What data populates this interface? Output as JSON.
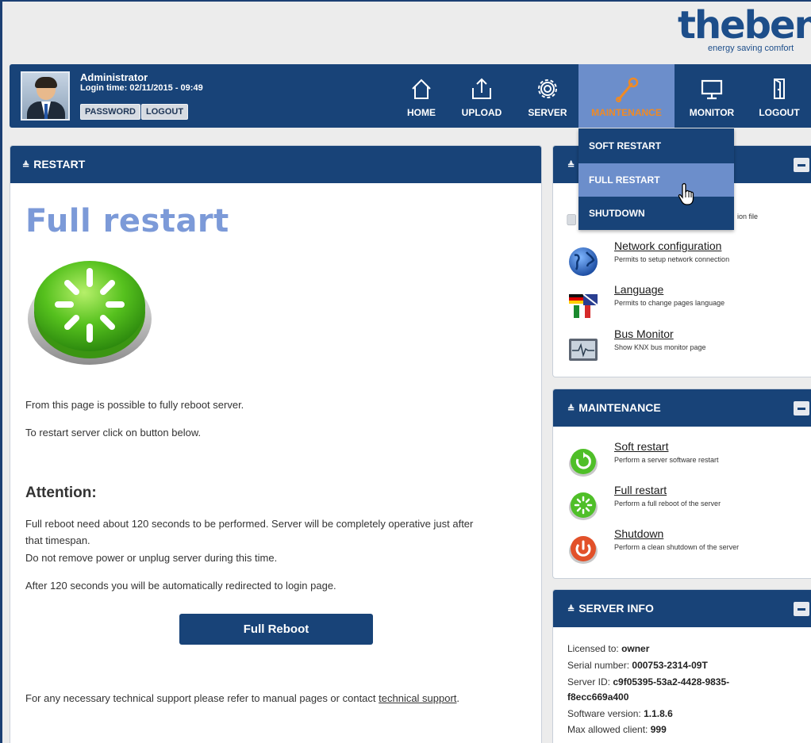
{
  "brand": {
    "logo_text": "theben",
    "tagline": "energy saving comfort"
  },
  "user": {
    "name": "Administrator",
    "login_time": "Login time: 02/11/2015 - 09:49",
    "password_label": "PASSWORD",
    "logout_label": "LOGOUT"
  },
  "nav": {
    "home": "HOME",
    "upload": "UPLOAD",
    "server": "SERVER",
    "maintenance": "MAINTENANCE",
    "monitor": "MONITOR",
    "logout": "LOGOUT"
  },
  "dropdown": {
    "items": [
      "SOFT RESTART",
      "FULL RESTART",
      "SHUTDOWN"
    ],
    "hovered": "FULL RESTART"
  },
  "main": {
    "header": "RESTART",
    "title": "Full restart",
    "intro1": "From this page is possible to fully reboot server.",
    "intro2": "To restart server click on button below.",
    "attention_title": "Attention:",
    "attention_line1": "Full reboot need about 120 seconds to be performed. Server will be completely operative just after",
    "attention_line2": "that timespan.",
    "attention_line3": "Do not remove power or unplug server during this time.",
    "redirect_note": "After 120 seconds you will be automatically redirected to login page.",
    "button_label": "Full Reboot",
    "support_prefix": "For any necessary technical support please refer to manual pages or contact ",
    "support_link": "technical support",
    "support_suffix": "."
  },
  "server_panel": {
    "partial_desc": "ion file",
    "items": [
      {
        "title": "Network configuration",
        "desc": "Permits to setup network connection"
      },
      {
        "title": "Language",
        "desc": "Permits to change pages language"
      },
      {
        "title": "Bus Monitor",
        "desc": "Show KNX bus monitor page"
      }
    ]
  },
  "maintenance_panel": {
    "header": "MAINTENANCE",
    "items": [
      {
        "title": "Soft restart",
        "desc": "Perform a server software restart"
      },
      {
        "title": "Full restart",
        "desc": "Perform a full reboot of the server"
      },
      {
        "title": "Shutdown",
        "desc": "Perform a clean shutdown of the server"
      }
    ]
  },
  "server_info": {
    "header": "SERVER INFO",
    "licensed_label": "Licensed to:",
    "licensed_value": "owner",
    "serial_label": "Serial number:",
    "serial_value": "000753-2314-09T",
    "server_id_label": "Server ID:",
    "server_id_value1": "c9f05395-53a2-4428-9835-",
    "server_id_value2": "f8ecc669a400",
    "software_label": "Software version:",
    "software_value": "1.1.8.6",
    "max_client_label": "Max allowed client:",
    "max_client_value": "999"
  },
  "colors": {
    "navy": "#184378",
    "active_tab": "#6c8ecb",
    "active_label": "#f08a24",
    "title_blue": "#7c9ad8"
  }
}
